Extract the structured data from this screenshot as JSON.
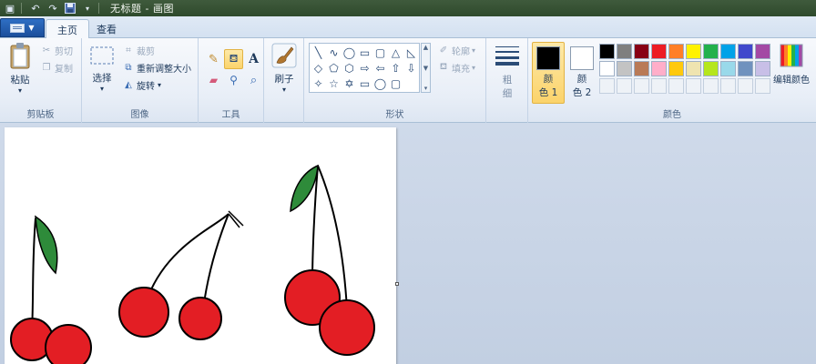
{
  "window": {
    "title": "无标题 - 画图"
  },
  "quick_access": {
    "app_icon": "paint-app-icon",
    "undo_icon": "undo-icon",
    "redo_icon": "redo-icon",
    "save_icon": "save-icon",
    "customize_icon": "dropdown-icon"
  },
  "tabs": [
    {
      "label": "主页",
      "active": true
    },
    {
      "label": "查看",
      "active": false
    }
  ],
  "ribbon": {
    "clipboard": {
      "group_label": "剪贴板",
      "paste_label": "粘贴",
      "cut_label": "剪切",
      "copy_label": "复制"
    },
    "image": {
      "group_label": "图像",
      "select_label": "选择",
      "crop_label": "裁剪",
      "resize_label": "重新调整大小",
      "rotate_label": "旋转"
    },
    "tools": {
      "group_label": "工具",
      "items": [
        "pencil-icon",
        "fill-icon",
        "text-icon",
        "eraser-icon",
        "color-picker-icon",
        "magnifier-icon"
      ]
    },
    "brushes": {
      "label": "刷子"
    },
    "shapes": {
      "group_label": "形状",
      "items": [
        "╲",
        "∿",
        "◯",
        "▭",
        "▢",
        "△",
        "◺",
        "◇",
        "⬠",
        "⬡",
        "⇨",
        "⇦",
        "⇧",
        "⇩",
        "✧",
        "☆",
        "✡",
        "▭",
        "◯",
        "▢"
      ],
      "outline_label": "轮廓",
      "fill_label": "填充"
    },
    "size": {
      "label_line1": "粗",
      "label_line2": "细"
    },
    "colors": {
      "group_label": "颜色",
      "color1_line1": "颜",
      "color1_line2": "色 1",
      "color1_value": "#000000",
      "color2_line1": "颜",
      "color2_line2": "色 2",
      "color2_value": "#ffffff",
      "edit_label": "编辑颜色",
      "palette_row1": [
        "#000000",
        "#7f7f7f",
        "#880015",
        "#ed1c24",
        "#ff7f27",
        "#fff200",
        "#22b14c",
        "#00a2e8",
        "#3f48cc",
        "#a349a4"
      ],
      "palette_row2": [
        "#ffffff",
        "#c3c3c3",
        "#b97a57",
        "#ffaec9",
        "#ffc90e",
        "#efe4b0",
        "#b5e61d",
        "#99d9ea",
        "#7092be",
        "#c8bfe7"
      ]
    }
  }
}
